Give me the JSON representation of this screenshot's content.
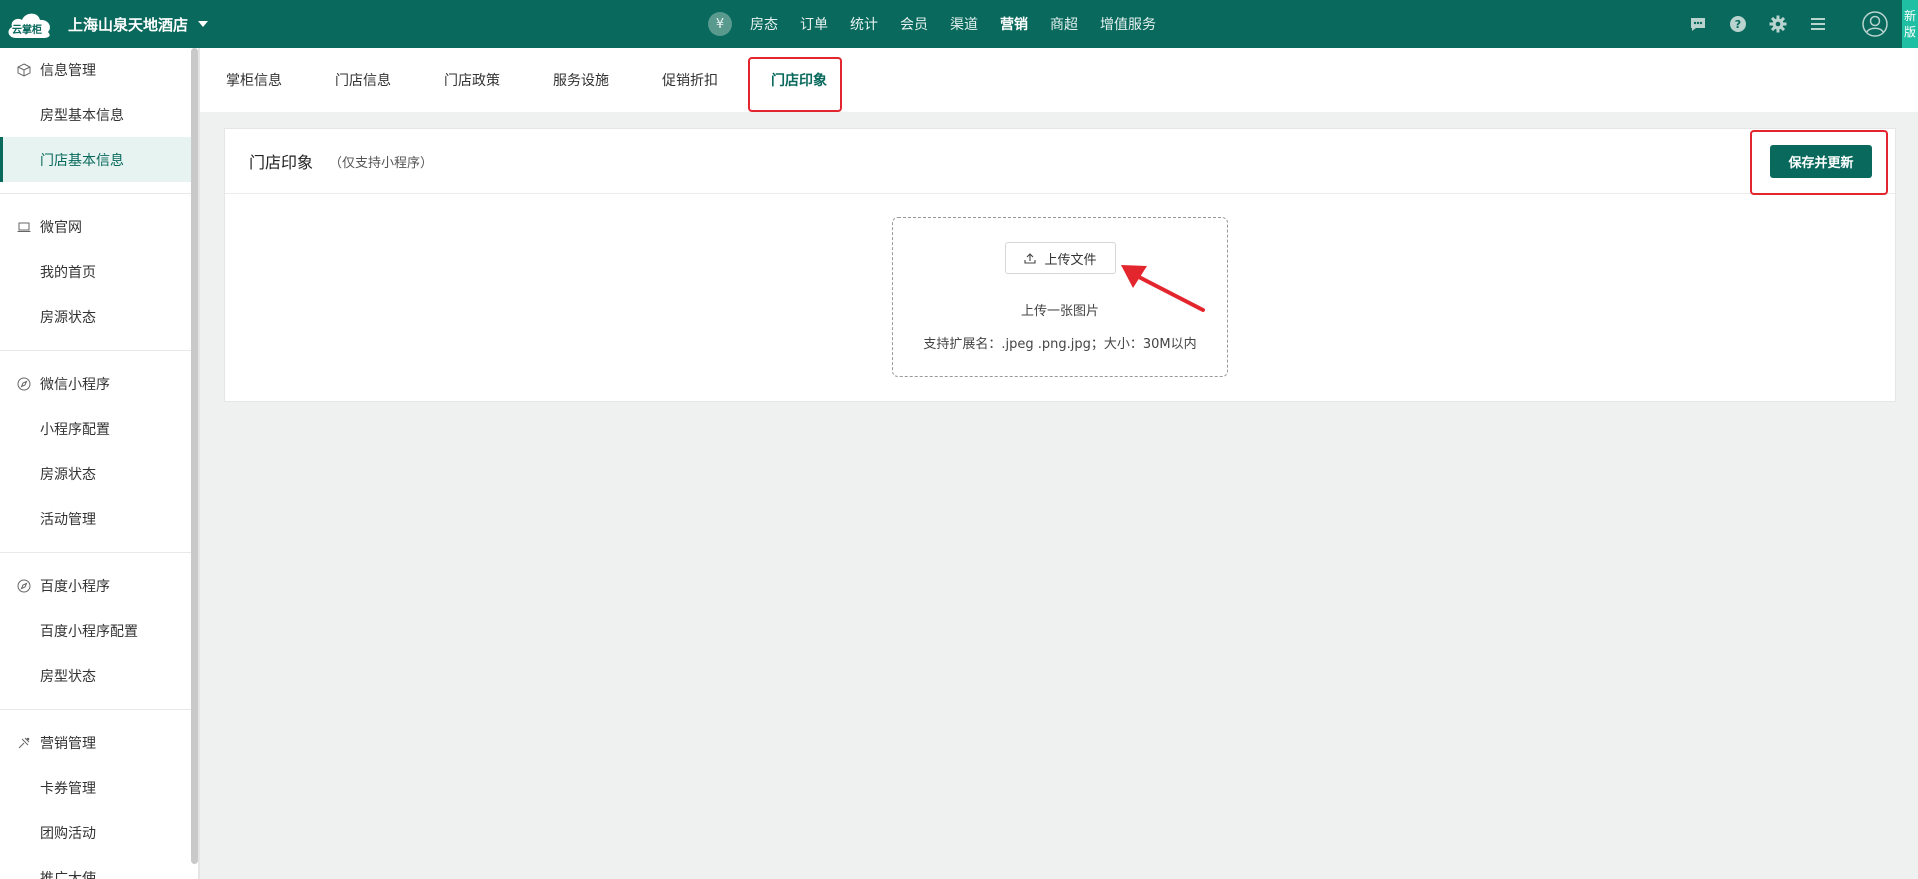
{
  "topbar": {
    "logo_text": "云掌柜",
    "hotel_name": "上海山泉天地酒店",
    "yen_symbol": "¥",
    "nav": [
      "房态",
      "订单",
      "统计",
      "会员",
      "渠道",
      "营销",
      "商超",
      "增值服务"
    ],
    "active_nav": "营销",
    "icons": [
      "message-icon",
      "help-icon",
      "gear-icon",
      "menu-icon"
    ],
    "new_version": "新版"
  },
  "sidebar": {
    "groups": [
      {
        "title": "信息管理",
        "icon": "cube-icon",
        "items": [
          "房型基本信息",
          "门店基本信息"
        ]
      },
      {
        "title": "微官网",
        "icon": "laptop-icon",
        "items": [
          "我的首页",
          "房源状态"
        ]
      },
      {
        "title": "微信小程序",
        "icon": "compass-icon",
        "items": [
          "小程序配置",
          "房源状态",
          "活动管理"
        ]
      },
      {
        "title": "百度小程序",
        "icon": "compass-icon",
        "items": [
          "百度小程序配置",
          "房型状态"
        ]
      },
      {
        "title": "营销管理",
        "icon": "marketing-icon",
        "items": [
          "卡券管理",
          "团购活动",
          "推广大使"
        ]
      }
    ],
    "active_item": "门店基本信息"
  },
  "tabs": {
    "items": [
      "掌柜信息",
      "门店信息",
      "门店政策",
      "服务设施",
      "促销折扣",
      "门店印象"
    ],
    "active": "门店印象"
  },
  "card": {
    "title": "门店印象",
    "subtitle": "（仅支持小程序）",
    "save_label": "保存并更新",
    "upload_label": "上传文件",
    "upload_hint": "上传一张图片",
    "upload_formats": "支持扩展名：.jpeg .png.jpg；大小：30M以内"
  },
  "colors": {
    "brand": "#08695c",
    "accent": "#1fbfa3",
    "highlight": "#e3262d"
  }
}
